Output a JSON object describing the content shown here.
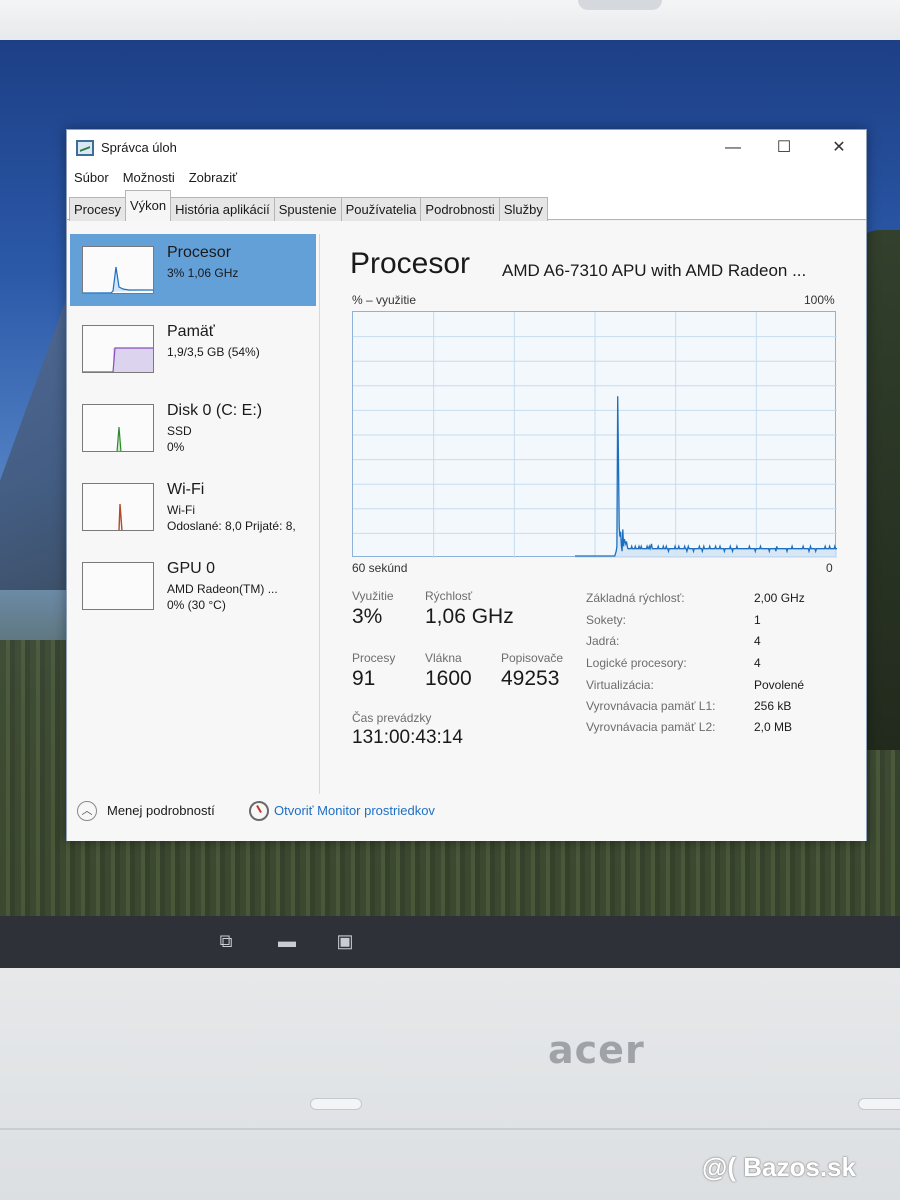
{
  "window": {
    "title": "Správca úloh",
    "controls": {
      "minimize": "—",
      "maximize": "☐",
      "close": "✕"
    }
  },
  "menu": [
    "Súbor",
    "Možnosti",
    "Zobraziť"
  ],
  "tabs": [
    "Procesy",
    "Výkon",
    "História aplikácií",
    "Spustenie",
    "Používatelia",
    "Podrobnosti",
    "Služby"
  ],
  "active_tab": "Výkon",
  "resources": [
    {
      "name": "Procesor",
      "line1": "3% 1,06 GHz",
      "selected": true
    },
    {
      "name": "Pamäť",
      "line1": "1,9/3,5 GB (54%)"
    },
    {
      "name": "Disk 0 (C: E:)",
      "line1": "SSD",
      "line2": "0%"
    },
    {
      "name": "Wi-Fi",
      "line1": "Wi-Fi",
      "line2": "Odoslané: 8,0 Prijaté: 8,"
    },
    {
      "name": "GPU 0",
      "line1": "AMD Radeon(TM) ...",
      "line2": "0% (30 °C)"
    }
  ],
  "detail": {
    "title": "Procesor",
    "model": "AMD A6-7310 APU with AMD Radeon ...",
    "graph_label_left": "% – využitie",
    "graph_label_right": "100%",
    "axis_left": "60 sekúnd",
    "axis_right": "0",
    "stats": {
      "util_label": "Využitie",
      "util_value": "3%",
      "speed_label": "Rýchlosť",
      "speed_value": "1,06 GHz",
      "proc_label": "Procesy",
      "proc_value": "91",
      "threads_label": "Vlákna",
      "threads_value": "1600",
      "handles_label": "Popisovače",
      "handles_value": "49253",
      "uptime_label": "Čas prevádzky",
      "uptime_value": "131:00:43:14"
    },
    "specs": [
      {
        "k": "Základná rýchlosť:",
        "v": "2,00 GHz"
      },
      {
        "k": "Sokety:",
        "v": "1"
      },
      {
        "k": "Jadrá:",
        "v": "4"
      },
      {
        "k": "Logické procesory:",
        "v": "4"
      },
      {
        "k": "Virtualizácia:",
        "v": "Povolené"
      },
      {
        "k": "Vyrovnávacia pamäť L1:",
        "v": "256 kB"
      },
      {
        "k": "Vyrovnávacia pamäť L2:",
        "v": "2,0 MB"
      }
    ]
  },
  "footer": {
    "less_details": "Menej podrobností",
    "resource_monitor": "Otvoriť Monitor prostriedkov"
  },
  "chart_data": {
    "type": "line",
    "x_range": [
      60,
      0
    ],
    "ylim": [
      0,
      100
    ],
    "grid": true,
    "series": [
      {
        "values": [
          0,
          0,
          0,
          0,
          0,
          0,
          0,
          0,
          0,
          0,
          0,
          0,
          0,
          0,
          0,
          0,
          0,
          0,
          0,
          0,
          0,
          0,
          0,
          0,
          0,
          0,
          0,
          0,
          0,
          0,
          0,
          0,
          0,
          0,
          0,
          0,
          0,
          0,
          0,
          0,
          0,
          0,
          0,
          0,
          0,
          0,
          0,
          0,
          0,
          0,
          0,
          0,
          0,
          0,
          0,
          1,
          2,
          4,
          66,
          42,
          12,
          8,
          10,
          4,
          2,
          11,
          4,
          7,
          6,
          5,
          6,
          4,
          3,
          3,
          3,
          3,
          3,
          4,
          3,
          3,
          3,
          3,
          4,
          3,
          3,
          3,
          3,
          4,
          3,
          3,
          4,
          3,
          3,
          3,
          3,
          3,
          3,
          3,
          4,
          3,
          3,
          4,
          3,
          4,
          5,
          3,
          3,
          3,
          3,
          3,
          3,
          3,
          3,
          4,
          3,
          3,
          3,
          3,
          3,
          3,
          4,
          3,
          3,
          3,
          4,
          3,
          3,
          2,
          3,
          3,
          3,
          3,
          3,
          3,
          3,
          3,
          4,
          3,
          3,
          3,
          3,
          4,
          3,
          3,
          3,
          3,
          3,
          3,
          3,
          4,
          3,
          3,
          2,
          3,
          4,
          3,
          3,
          3,
          3,
          3,
          3,
          2,
          3,
          3,
          3,
          3,
          3,
          3,
          3,
          4,
          3,
          3,
          3,
          2,
          3,
          4,
          3,
          3,
          3,
          3,
          3,
          3,
          3,
          4,
          3,
          3,
          3,
          3,
          3,
          3,
          3,
          4,
          3,
          3,
          3,
          3,
          3,
          4,
          3,
          3,
          3,
          3,
          3,
          2,
          3,
          3,
          3,
          3,
          3,
          3,
          3,
          4,
          3,
          3,
          2,
          3,
          3,
          3,
          3,
          3,
          4,
          3,
          3,
          3,
          3,
          3,
          3,
          3,
          3,
          3,
          3,
          3,
          3,
          3,
          3,
          3,
          3,
          4,
          3,
          3,
          3,
          3,
          3,
          3,
          3,
          2,
          3,
          3,
          3,
          3,
          3,
          3,
          4,
          3,
          3,
          3,
          3,
          3,
          3,
          3,
          3,
          3,
          3,
          3,
          2,
          3,
          3,
          3,
          3,
          3,
          3,
          3,
          3,
          2,
          4,
          3,
          3,
          3,
          3,
          3,
          3,
          3,
          3,
          3,
          3,
          3,
          3,
          3,
          2,
          3,
          3,
          3,
          3,
          3,
          3,
          4,
          3,
          3,
          3,
          3,
          3,
          3,
          3,
          3,
          3,
          3,
          3,
          3,
          3,
          3,
          4,
          3,
          3,
          3,
          3,
          3,
          3,
          3,
          2,
          3,
          4,
          3,
          3,
          3,
          3,
          3,
          3,
          2,
          3,
          3,
          3,
          3,
          3,
          3,
          3,
          3,
          3,
          3,
          3,
          3,
          4,
          3,
          3,
          3,
          3,
          3,
          4,
          3,
          3,
          3,
          3,
          3,
          3,
          4,
          3,
          3,
          3
        ]
      }
    ],
    "colors": {
      "line": "#1c6fbf",
      "fill": "#cfe2f4",
      "grid": "#c6dcef"
    }
  }
}
